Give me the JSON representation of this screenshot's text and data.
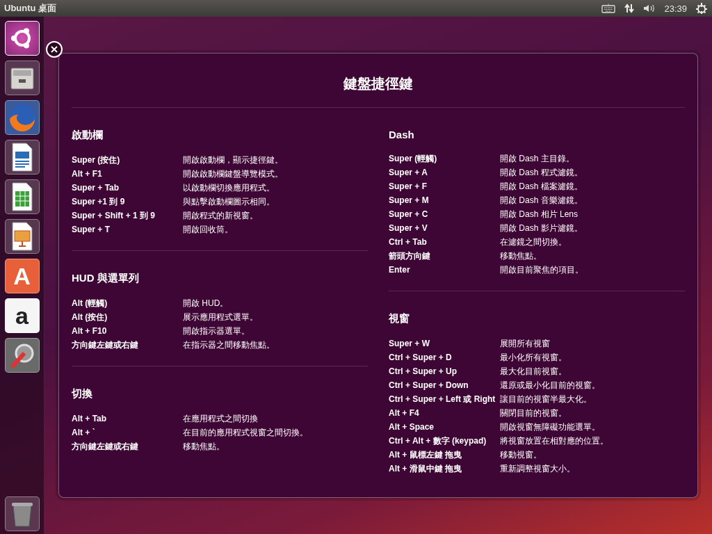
{
  "top_bar": {
    "title": "Ubuntu 桌面",
    "clock": "23:39"
  },
  "launcher": {
    "items": [
      {
        "kind": "logo",
        "selected": true
      },
      {
        "kind": "files",
        "selected": false
      },
      {
        "kind": "browser",
        "selected": false
      },
      {
        "kind": "writer",
        "selected": false
      },
      {
        "kind": "calc",
        "selected": false
      },
      {
        "kind": "impress",
        "selected": false
      },
      {
        "kind": "store",
        "selected": false,
        "glyph": "A"
      },
      {
        "kind": "shop",
        "selected": false,
        "glyph": "a"
      },
      {
        "kind": "settings",
        "selected": false
      }
    ]
  },
  "overlay": {
    "title": "鍵盤捷徑鍵",
    "columns": [
      [
        {
          "title": "啟動欄",
          "shortcuts": [
            {
              "keys": "Super (按住)",
              "action": "開啟啟動欄，顯示捷徑鍵。"
            },
            {
              "keys": "Alt + F1",
              "action": "開啟啟動欄鍵盤導覽模式。"
            },
            {
              "keys": "Super + Tab",
              "action": "以啟動欄切換應用程式。"
            },
            {
              "keys": "Super +1 到 9",
              "action": "與點擊啟動欄圖示相同。"
            },
            {
              "keys": "Super + Shift + 1 到 9",
              "action": "開啟程式的新視窗。"
            },
            {
              "keys": "Super + T",
              "action": "開啟回收筒。"
            }
          ]
        },
        {
          "title": "HUD 與選單列",
          "shortcuts": [
            {
              "keys": "Alt (輕觸)",
              "action": "開啟 HUD。"
            },
            {
              "keys": "Alt (按住)",
              "action": "展示應用程式選單。"
            },
            {
              "keys": "Alt + F10",
              "action": "開啟指示器選單。"
            },
            {
              "keys": "方向鍵左鍵或右鍵",
              "action": "在指示器之間移動焦點。"
            }
          ]
        },
        {
          "title": "切換",
          "shortcuts": [
            {
              "keys": "Alt + Tab",
              "action": "在應用程式之間切換"
            },
            {
              "keys": "Alt + `",
              "action": "在目前的應用程式視窗之間切換。"
            },
            {
              "keys": "方向鍵左鍵或右鍵",
              "action": "移動焦點。"
            }
          ]
        }
      ],
      [
        {
          "title": "Dash",
          "shortcuts": [
            {
              "keys": "Super (輕觸)",
              "action": "開啟 Dash 主目錄。"
            },
            {
              "keys": "Super + A",
              "action": "開啟 Dash 程式濾鏡。"
            },
            {
              "keys": "Super + F",
              "action": "開啟 Dash 檔案濾鏡。"
            },
            {
              "keys": "Super + M",
              "action": "開啟 Dash 音樂濾鏡。"
            },
            {
              "keys": "Super + C",
              "action": "開啟 Dash 相片 Lens"
            },
            {
              "keys": "Super + V",
              "action": "開啟 Dash 影片濾鏡。"
            },
            {
              "keys": "Ctrl + Tab",
              "action": "在濾鏡之間切換。"
            },
            {
              "keys": "箭頭方向鍵",
              "action": "移動焦點。"
            },
            {
              "keys": "Enter",
              "action": "開啟目前聚焦的項目。"
            }
          ]
        },
        {
          "title": "視窗",
          "shortcuts": [
            {
              "keys": "Super + W",
              "action": "展開所有視窗"
            },
            {
              "keys": "Ctrl + Super + D",
              "action": "最小化所有視窗。"
            },
            {
              "keys": "Ctrl + Super + Up",
              "action": "最大化目前視窗。"
            },
            {
              "keys": "Ctrl + Super + Down",
              "action": "還原或最小化目前的視窗。"
            },
            {
              "keys": "Ctrl + Super + Left 或 Right",
              "action": "讓目前的視窗半最大化。"
            },
            {
              "keys": "Alt + F4",
              "action": "關閉目前的視窗。"
            },
            {
              "keys": "Alt + Space",
              "action": "開啟視窗無障礙功能選單。"
            },
            {
              "keys": "Ctrl + Alt + 數字 (keypad)",
              "action": "將視窗放置在相對應的位置。"
            },
            {
              "keys": "Alt + 鼠標左鍵 拖曳",
              "action": "移動視窗。"
            },
            {
              "keys": "Alt + 滑鼠中鍵 拖曳",
              "action": "重新調整視窗大小。"
            }
          ]
        }
      ]
    ]
  }
}
